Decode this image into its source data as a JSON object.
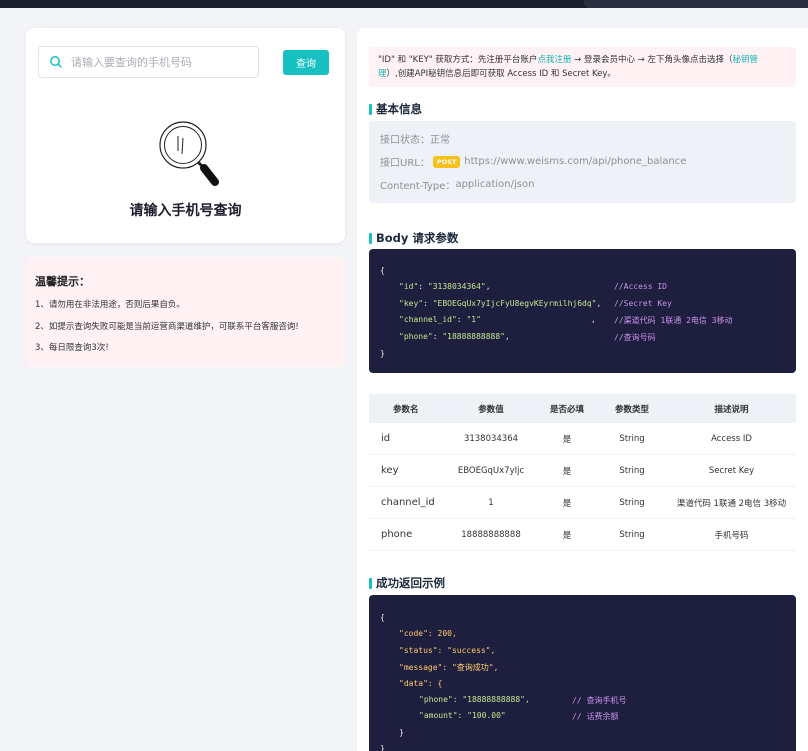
{
  "search": {
    "placeholder": "请输入要查询的手机号码",
    "button_label": "查询",
    "empty_title": "请输入手机号查询"
  },
  "tips": {
    "title": "温馨提示：",
    "items": [
      "1、请勿用在非法用途，否则后果自负。",
      "2、如提示查询失败可能是当前运营商渠道维护，可联系平台客服咨询!",
      "3、每日限查询3次!"
    ]
  },
  "notice": {
    "line1_prefix": "\"ID\" 和 \"KEY\" 获取方式：先注册平台账户",
    "link_register": "点我注册",
    "line1_mid": " → 登录会员中心 → 左下角头像点击选择（",
    "link_key_mgmt_a": "秘钥管",
    "link_key_mgmt_b": "理",
    "line2_suffix": "）,创建API秘钥信息后即可获取 Access ID 和 Secret Key。"
  },
  "basic_info": {
    "title": "基本信息",
    "status_label": "接口状态：",
    "status_value": "正常",
    "url_label": "接口URL：",
    "method": "POST",
    "url": "https://www.weisms.com/api/phone_balance",
    "content_type_label": "Content-Type：",
    "content_type_value": "application/json"
  },
  "body_params": {
    "title": "Body 请求参数",
    "code": {
      "open": "{",
      "close": "}",
      "lines": [
        {
          "key": "\"id\"",
          "value": "\"3138034364\"",
          "comment": "//Access ID"
        },
        {
          "key": "\"key\"",
          "value": "\"EBOEGqUx7yIjcFyU8egvKEyrmilhj6dq\"",
          "comment": "//Secret Key"
        },
        {
          "key": "\"channel_id\"",
          "value": "\"1\"",
          "comment": "//渠道代码 1联通 2电信 3移动"
        },
        {
          "key": "\"phone\"",
          "value": "\"18888888888\"",
          "comment": "//查询号码"
        }
      ]
    }
  },
  "param_table": {
    "headers": [
      "参数名",
      "参数值",
      "是否必填",
      "参数类型",
      "描述说明"
    ],
    "rows": [
      [
        "id",
        "3138034364",
        "是",
        "String",
        "Access ID"
      ],
      [
        "key",
        "EBOEGqUx7yIjc",
        "是",
        "String",
        "Secret Key"
      ],
      [
        "channel_id",
        "1",
        "是",
        "String",
        "渠道代码 1联通 2电信 3移动"
      ],
      [
        "phone",
        "18888888888",
        "是",
        "String",
        "手机号码"
      ]
    ]
  },
  "success_example": {
    "title": "成功返回示例",
    "code": {
      "open": "{",
      "l1": "\"code\": 200,",
      "l2": "\"status\": \"success\",",
      "l3": "\"message\": \"查询成功\",",
      "l4": "\"data\": {",
      "l5_key": "\"phone\"",
      "l5_val": ": \"18888888888\",",
      "l5_comment": "// 查询手机号",
      "l6_key": "\"amount\"",
      "l6_val": ": \"100.00\"",
      "l6_comment": "// 话费余额",
      "l7": "}",
      "close": "}"
    }
  },
  "colors": {
    "accent": "#17c1c1",
    "code_bg": "#1e1e3e",
    "tips_bg": "#fff1f4",
    "post_badge": "#f6c11a"
  }
}
